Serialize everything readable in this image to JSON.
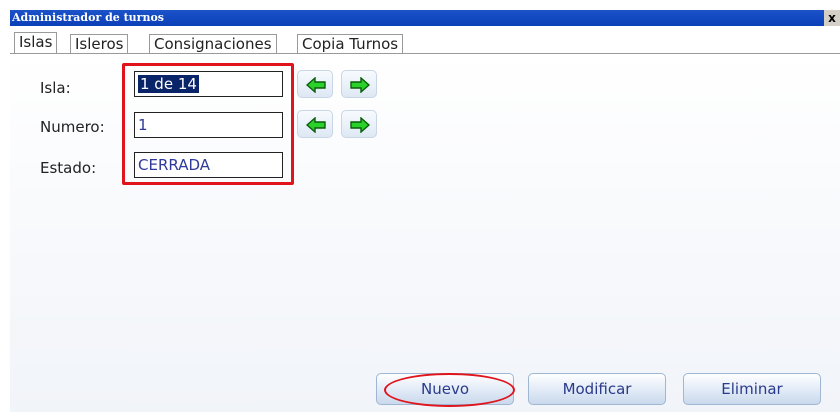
{
  "window": {
    "title": "Administrador de turnos",
    "close_label": "x"
  },
  "tabs": [
    {
      "label": "Islas"
    },
    {
      "label": "Isleros"
    },
    {
      "label": "Consignaciones"
    },
    {
      "label": "Copia Turnos"
    }
  ],
  "form": {
    "isla_label": "Isla:",
    "isla_value": "1 de 14",
    "numero_label": "Numero:",
    "numero_value": "1",
    "estado_label": "Estado:",
    "estado_value": "CERRADA"
  },
  "buttons": {
    "nuevo": "Nuevo",
    "modificar": "Modificar",
    "eliminar": "Eliminar"
  },
  "colors": {
    "titlebar": "#0a3fb8",
    "arrow_green": "#2bd12b",
    "annotation_red": "#e0141c",
    "field_text": "#2f3a9a"
  },
  "icons": {
    "prev": "left-arrow-icon",
    "next": "right-arrow-icon"
  }
}
